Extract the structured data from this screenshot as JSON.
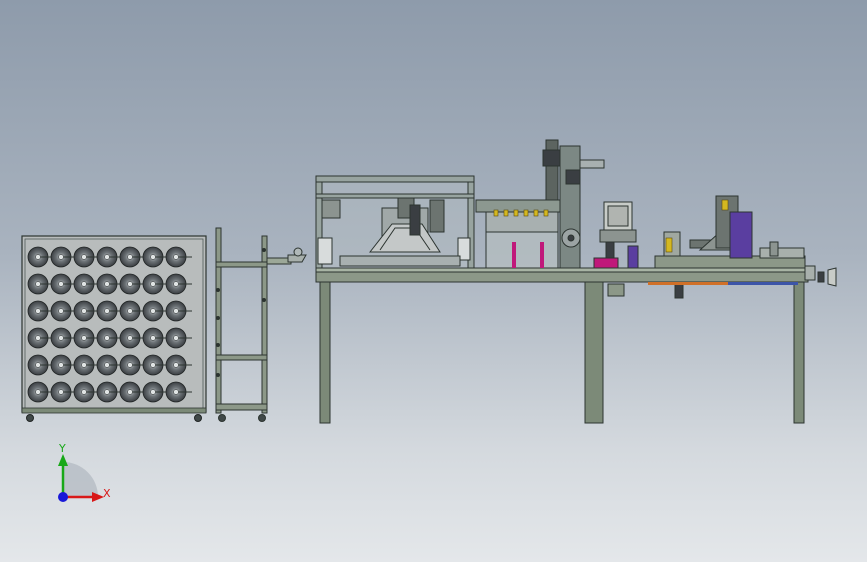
{
  "scene": {
    "spool_rack": {
      "rows": 6,
      "cols": 7
    },
    "colors": {
      "background_top": "#8e9bab",
      "background_bottom": "#e4e7ea",
      "frame_green": "#7c8a78",
      "frame_dark": "#2c3430",
      "accent_magenta": "#c0187a",
      "accent_purple": "#5a3ea0",
      "accent_blue": "#3c55a8",
      "accent_orange": "#d07028"
    }
  },
  "triad": {
    "y_label": "Y",
    "x_label": "X",
    "y_color": "#18a818",
    "x_color": "#d81818",
    "z_color": "#1818d8"
  }
}
